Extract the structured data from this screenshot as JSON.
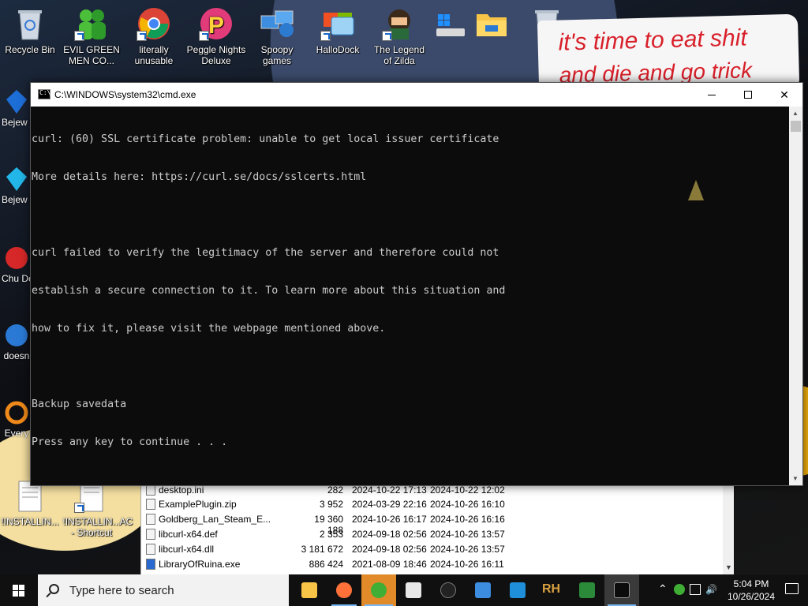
{
  "desktop": {
    "top_icons": [
      {
        "label": "Recycle Bin"
      },
      {
        "label": "EVIL GREEN MEN CO..."
      },
      {
        "label": "literally unusable"
      },
      {
        "label": "Peggle Nights Deluxe"
      },
      {
        "label": "Spoopy games"
      },
      {
        "label": "HalloDock"
      },
      {
        "label": "The Legend of Zilda"
      }
    ],
    "left_icons": [
      {
        "label": "Bejew Del"
      },
      {
        "label": "Bejew Del"
      },
      {
        "label": "Chu Del"
      },
      {
        "label": "doesn"
      },
      {
        "label": "Every"
      }
    ],
    "bottom_icons": [
      {
        "label": "!INSTALLIN..."
      },
      {
        "label": "!INSTALLIN... - Shortcut"
      },
      {
        "label": "AC"
      }
    ],
    "meme": {
      "line1": "it's time to eat shit",
      "line2": "and die and go trick"
    }
  },
  "cmd_window": {
    "title": "C:\\WINDOWS\\system32\\cmd.exe",
    "lines": [
      "curl: (60) SSL certificate problem: unable to get local issuer certificate",
      "More details here: https://curl.se/docs/sslcerts.html",
      "",
      "curl failed to verify the legitimacy of the server and therefore could not",
      "establish a secure connection to it. To learn more about this situation and",
      "how to fix it, please visit the webpage mentioned above.",
      "",
      "Backup savedata",
      "Press any key to continue . . ."
    ],
    "minimize": "—",
    "maximize": "☐",
    "close": "✕"
  },
  "explorer": {
    "files": [
      {
        "name": "desktop.ini",
        "size": "282",
        "modified": "2024-10-22 17:13",
        "created": "2024-10-22 12:02"
      },
      {
        "name": "ExamplePlugin.zip",
        "size": "3 952",
        "modified": "2024-03-29 22:16",
        "created": "2024-10-26 16:10"
      },
      {
        "name": "Goldberg_Lan_Steam_E...",
        "size": "19 360 188",
        "modified": "2024-10-26 16:17",
        "created": "2024-10-26 16:16"
      },
      {
        "name": "libcurl-x64.def",
        "size": "2 353",
        "modified": "2024-09-18 02:56",
        "created": "2024-10-26 13:57"
      },
      {
        "name": "libcurl-x64.dll",
        "size": "3 181 672",
        "modified": "2024-09-18 02:56",
        "created": "2024-10-26 13:57"
      },
      {
        "name": "LibraryOfRuina.exe",
        "size": "886 424",
        "modified": "2021-08-09 18:46",
        "created": "2024-10-26 16:11"
      }
    ]
  },
  "taskbar": {
    "search_placeholder": "Type here to search",
    "apps": [
      "file-explorer",
      "firefox",
      "green-men",
      "7zip",
      "circle-app",
      "notepad-app",
      "photos-app",
      "rh-app",
      "spreadsheet-app",
      "cmd"
    ],
    "clock_time": "5:04 PM",
    "clock_date": "10/26/2024"
  }
}
